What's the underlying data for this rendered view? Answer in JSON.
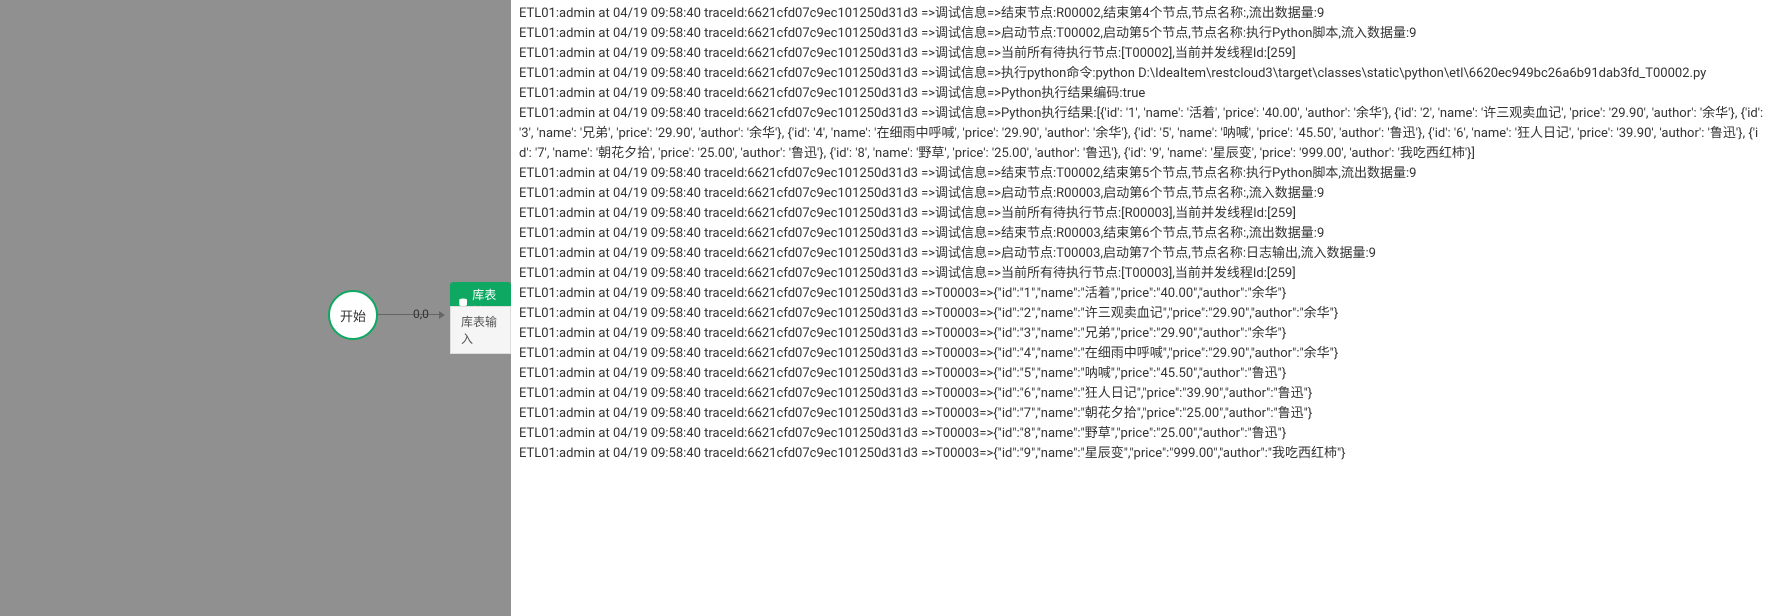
{
  "flow": {
    "start_label": "开始",
    "edge_label": "0,0",
    "action_header": "库表输",
    "action_body": "库表输入"
  },
  "log_prefix": "ETL01:admin at 04/19 09:58:40 traceId:6621cfd07c9ec101250d31d3 =>",
  "logs": [
    "ETL01:admin at 04/19 09:58:40 traceId:6621cfd07c9ec101250d31d3 =>调试信息=>结束节点:R00002,结束第4个节点,节点名称:,流出数据量:9",
    "ETL01:admin at 04/19 09:58:40 traceId:6621cfd07c9ec101250d31d3 =>调试信息=>启动节点:T00002,启动第5个节点,节点名称:执行Python脚本,流入数据量:9",
    "ETL01:admin at 04/19 09:58:40 traceId:6621cfd07c9ec101250d31d3 =>调试信息=>当前所有待执行节点:[T00002],当前并发线程Id:[259]",
    "ETL01:admin at 04/19 09:58:40 traceId:6621cfd07c9ec101250d31d3 =>调试信息=>执行python命令:python D:\\IdeaItem\\restcloud3\\target\\classes\\static\\python\\etl\\6620ec949bc26a6b91dab3fd_T00002.py",
    "ETL01:admin at 04/19 09:58:40 traceId:6621cfd07c9ec101250d31d3 =>调试信息=>Python执行结果编码:true",
    "ETL01:admin at 04/19 09:58:40 traceId:6621cfd07c9ec101250d31d3 =>调试信息=>Python执行结果:[{'id': '1', 'name': '活着', 'price': '40.00', 'author': '余华'}, {'id': '2', 'name': '许三观卖血记', 'price': '29.90', 'author': '余华'}, {'id': '3', 'name': '兄弟', 'price': '29.90', 'author': '余华'}, {'id': '4', 'name': '在细雨中呼喊', 'price': '29.90', 'author': '余华'}, {'id': '5', 'name': '呐喊', 'price': '45.50', 'author': '鲁迅'}, {'id': '6', 'name': '狂人日记', 'price': '39.90', 'author': '鲁迅'}, {'id': '7', 'name': '朝花夕拾', 'price': '25.00', 'author': '鲁迅'}, {'id': '8', 'name': '野草', 'price': '25.00', 'author': '鲁迅'}, {'id': '9', 'name': '星辰变', 'price': '999.00', 'author': '我吃西红柿'}]",
    "ETL01:admin at 04/19 09:58:40 traceId:6621cfd07c9ec101250d31d3 =>调试信息=>结束节点:T00002,结束第5个节点,节点名称:执行Python脚本,流出数据量:9",
    "ETL01:admin at 04/19 09:58:40 traceId:6621cfd07c9ec101250d31d3 =>调试信息=>启动节点:R00003,启动第6个节点,节点名称:,流入数据量:9",
    "ETL01:admin at 04/19 09:58:40 traceId:6621cfd07c9ec101250d31d3 =>调试信息=>当前所有待执行节点:[R00003],当前并发线程Id:[259]",
    "ETL01:admin at 04/19 09:58:40 traceId:6621cfd07c9ec101250d31d3 =>调试信息=>结束节点:R00003,结束第6个节点,节点名称:,流出数据量:9",
    "ETL01:admin at 04/19 09:58:40 traceId:6621cfd07c9ec101250d31d3 =>调试信息=>启动节点:T00003,启动第7个节点,节点名称:日志输出,流入数据量:9",
    "ETL01:admin at 04/19 09:58:40 traceId:6621cfd07c9ec101250d31d3 =>调试信息=>当前所有待执行节点:[T00003],当前并发线程Id:[259]",
    "ETL01:admin at 04/19 09:58:40 traceId:6621cfd07c9ec101250d31d3 =>T00003=>{\"id\":\"1\",\"name\":\"活着\",\"price\":\"40.00\",\"author\":\"余华\"}",
    "ETL01:admin at 04/19 09:58:40 traceId:6621cfd07c9ec101250d31d3 =>T00003=>{\"id\":\"2\",\"name\":\"许三观卖血记\",\"price\":\"29.90\",\"author\":\"余华\"}",
    "ETL01:admin at 04/19 09:58:40 traceId:6621cfd07c9ec101250d31d3 =>T00003=>{\"id\":\"3\",\"name\":\"兄弟\",\"price\":\"29.90\",\"author\":\"余华\"}",
    "ETL01:admin at 04/19 09:58:40 traceId:6621cfd07c9ec101250d31d3 =>T00003=>{\"id\":\"4\",\"name\":\"在细雨中呼喊\",\"price\":\"29.90\",\"author\":\"余华\"}",
    "ETL01:admin at 04/19 09:58:40 traceId:6621cfd07c9ec101250d31d3 =>T00003=>{\"id\":\"5\",\"name\":\"呐喊\",\"price\":\"45.50\",\"author\":\"鲁迅\"}",
    "ETL01:admin at 04/19 09:58:40 traceId:6621cfd07c9ec101250d31d3 =>T00003=>{\"id\":\"6\",\"name\":\"狂人日记\",\"price\":\"39.90\",\"author\":\"鲁迅\"}",
    "ETL01:admin at 04/19 09:58:40 traceId:6621cfd07c9ec101250d31d3 =>T00003=>{\"id\":\"7\",\"name\":\"朝花夕拾\",\"price\":\"25.00\",\"author\":\"鲁迅\"}",
    "ETL01:admin at 04/19 09:58:40 traceId:6621cfd07c9ec101250d31d3 =>T00003=>{\"id\":\"8\",\"name\":\"野草\",\"price\":\"25.00\",\"author\":\"鲁迅\"}",
    "ETL01:admin at 04/19 09:58:40 traceId:6621cfd07c9ec101250d31d3 =>T00003=>{\"id\":\"9\",\"name\":\"星辰变\",\"price\":\"999.00\",\"author\":\"我吃西红柿\"}"
  ]
}
